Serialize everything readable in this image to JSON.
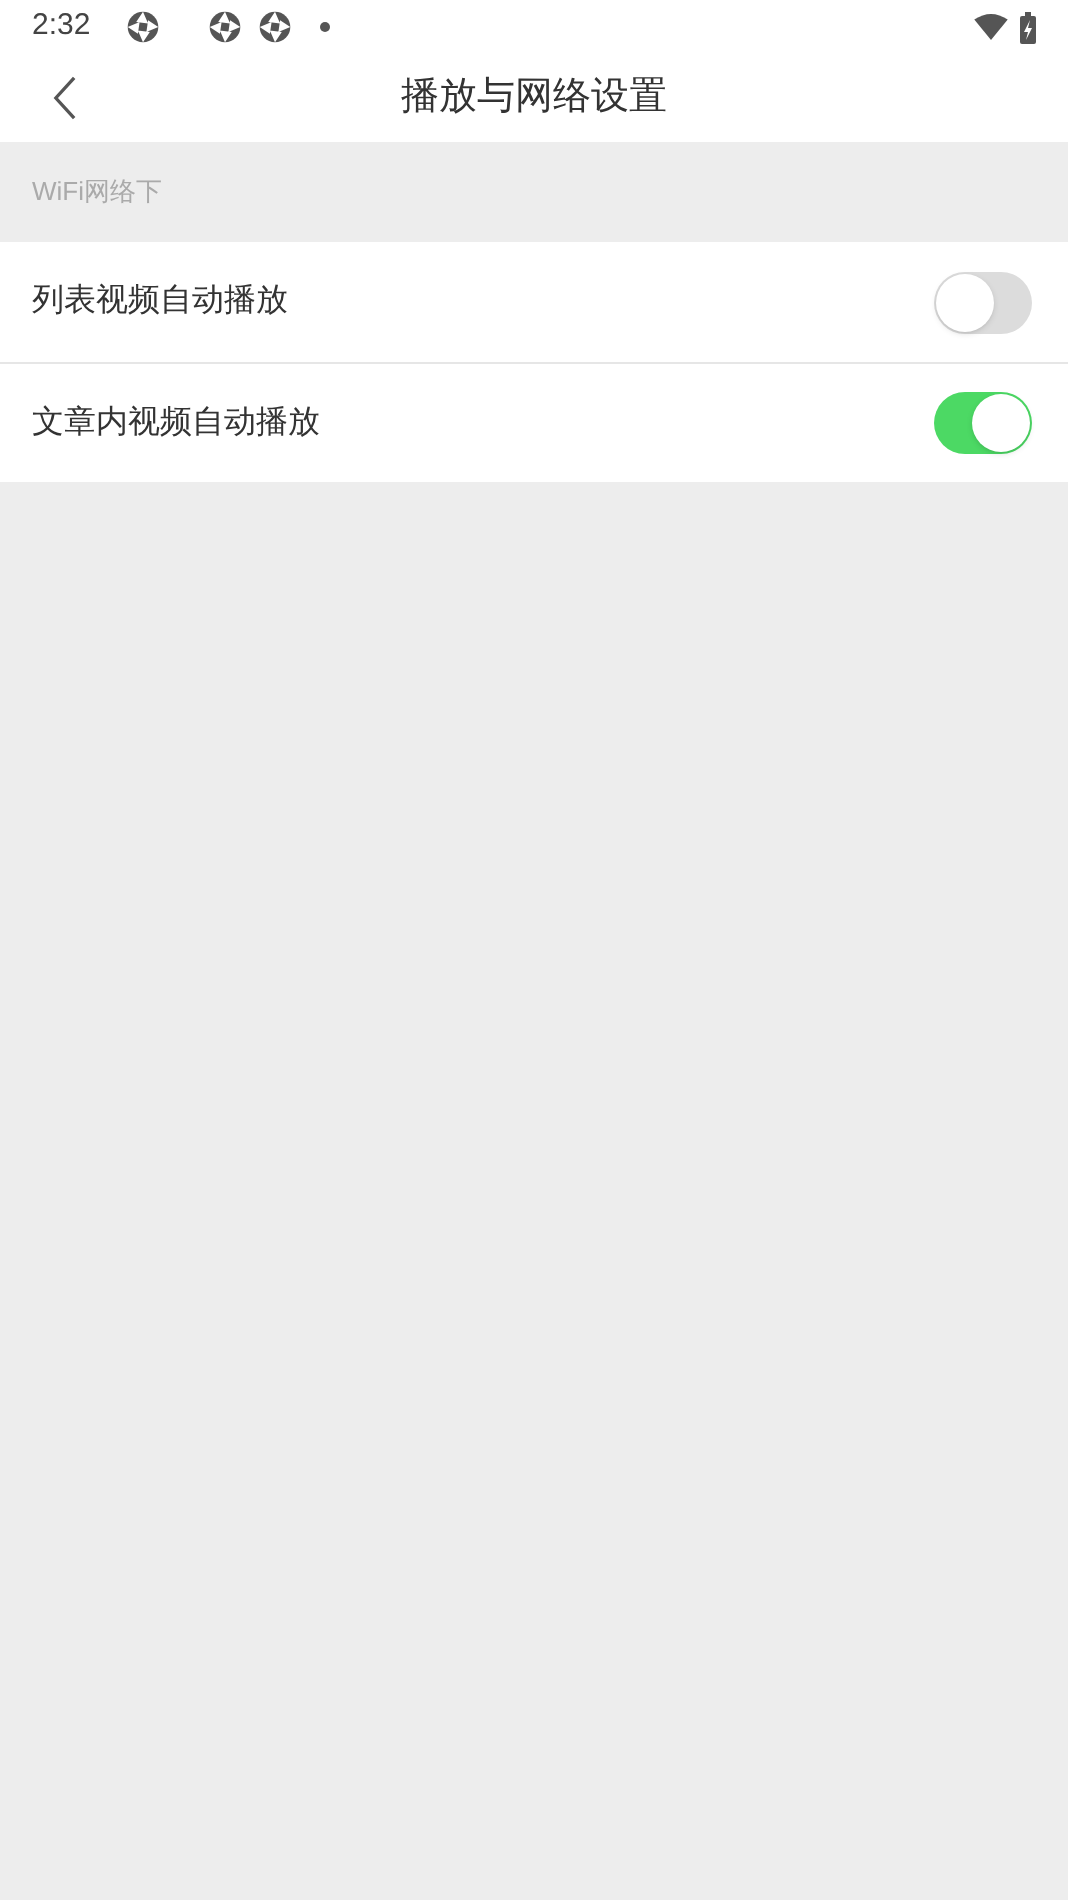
{
  "status_bar": {
    "time": "2:32"
  },
  "header": {
    "title": "播放与网络设置"
  },
  "section": {
    "label": "WiFi网络下"
  },
  "settings": [
    {
      "label": "列表视频自动播放",
      "on": false
    },
    {
      "label": "文章内视频自动播放",
      "on": true
    }
  ]
}
